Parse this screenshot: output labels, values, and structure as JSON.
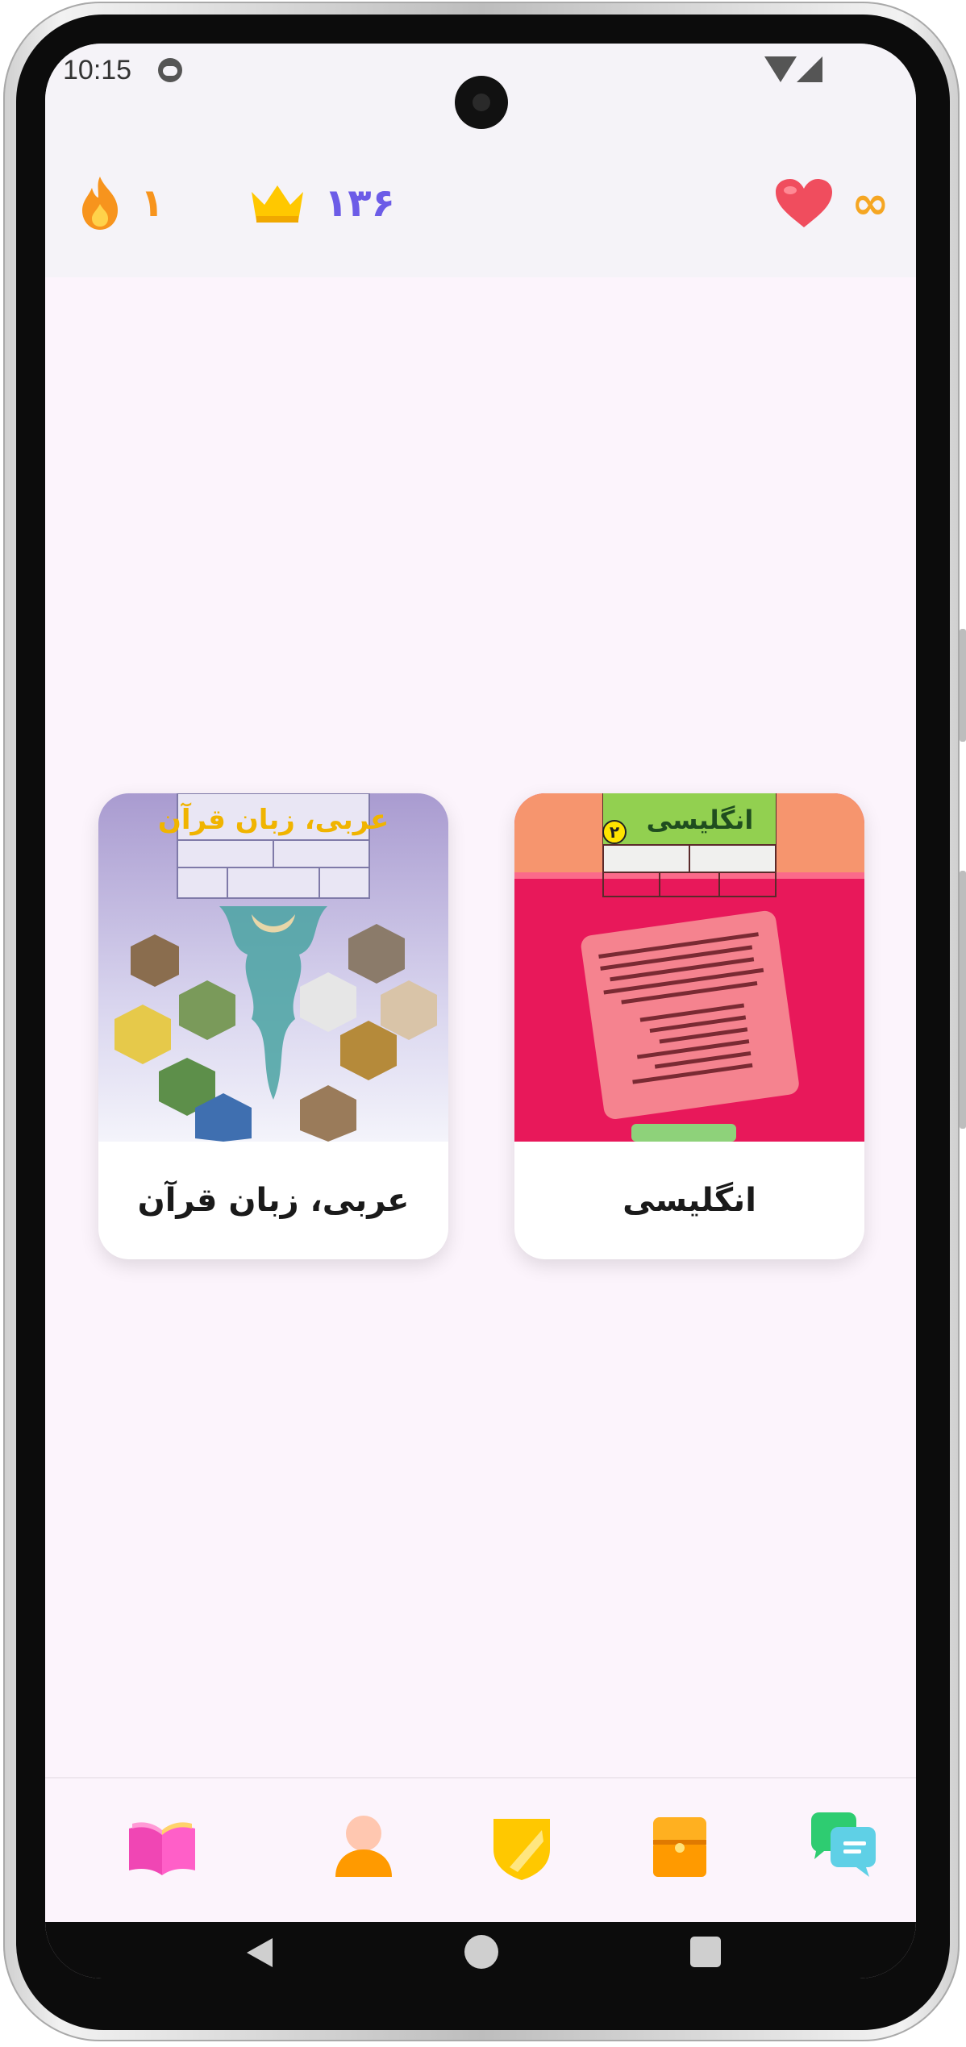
{
  "status_bar": {
    "time": "10:15"
  },
  "header": {
    "streak": {
      "value": "۱",
      "icon": "fire-icon",
      "color": "#f7941d"
    },
    "crowns": {
      "value": "۱۳۶",
      "icon": "crown-icon",
      "color": "#6c5ce7"
    },
    "hearts": {
      "value": "∞",
      "icon": "heart-icon",
      "color": "#f5a623"
    }
  },
  "books": [
    {
      "title": "انگلیسی",
      "cover_text": "انگلیسی"
    },
    {
      "title": "عربی، زبان قرآن",
      "cover_text": "عربی، زبان قرآن"
    }
  ],
  "bottom_nav": {
    "items": [
      {
        "name": "learn",
        "icon": "book-icon"
      },
      {
        "name": "profile",
        "icon": "user-icon"
      },
      {
        "name": "leagues",
        "icon": "shield-icon"
      },
      {
        "name": "shop",
        "icon": "chest-icon"
      },
      {
        "name": "chat",
        "icon": "chat-icon"
      }
    ]
  },
  "colors": {
    "accent_purple": "#6c5ce7",
    "fire_orange": "#f7941d",
    "heart_red": "#f04d5e",
    "infinity_gold": "#f5a623",
    "background": "#fcf4fc"
  }
}
